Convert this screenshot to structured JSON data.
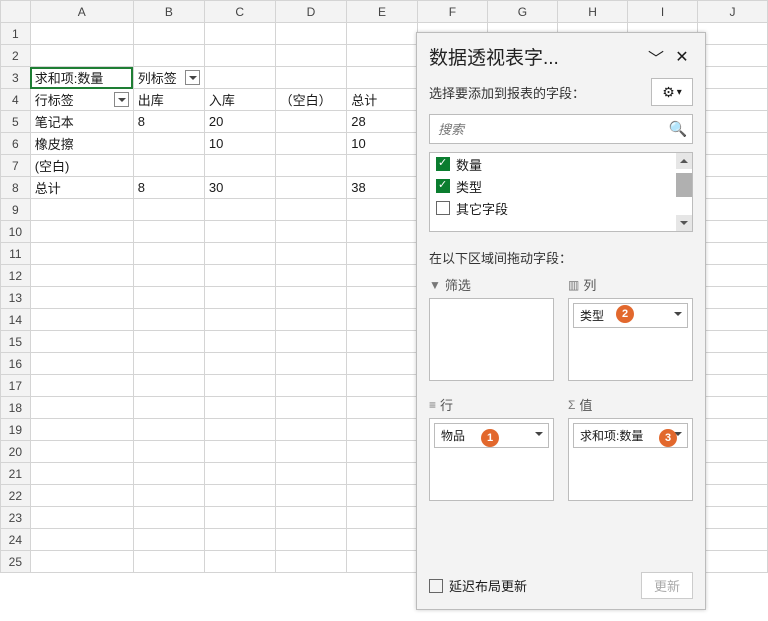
{
  "columns": [
    "A",
    "B",
    "C",
    "D",
    "E",
    "F",
    "G",
    "H",
    "I",
    "J"
  ],
  "rows_count": 25,
  "pivot": {
    "a3": "求和项:数量",
    "b3": "列标签",
    "a4": "行标签",
    "col_headers": [
      "出库",
      "入库",
      "（空白）",
      "总计"
    ],
    "row_labels": [
      "笔记本",
      "橡皮擦",
      "(空白)",
      "总计"
    ],
    "data": [
      [
        "8",
        "20",
        "",
        "28"
      ],
      [
        "",
        "10",
        "",
        "10"
      ],
      [
        "",
        "",
        "",
        ""
      ],
      [
        "8",
        "30",
        "",
        "38"
      ]
    ]
  },
  "pane": {
    "title": "数据透视表字...",
    "subtitle": "选择要添加到报表的字段：",
    "search_placeholder": "搜索",
    "fields": [
      {
        "label": "数量",
        "checked": true
      },
      {
        "label": "类型",
        "checked": true
      },
      {
        "label": "其它字段",
        "checked": false
      }
    ],
    "areas_label": "在以下区域间拖动字段：",
    "area_filter": "筛选",
    "area_columns": "列",
    "area_rows": "行",
    "area_values": "值",
    "rows_pill": "物品",
    "columns_pill": "类型",
    "values_pill": "求和项:数量",
    "defer_label": "延迟布局更新",
    "update_btn": "更新"
  },
  "annotations": {
    "b1": "1",
    "b2": "2",
    "b3": "3"
  }
}
